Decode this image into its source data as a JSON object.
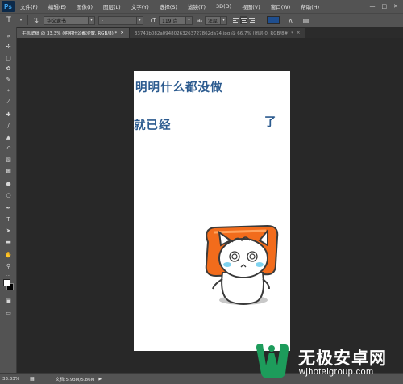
{
  "app": {
    "logo": "Ps"
  },
  "menu": {
    "items": [
      "文件(F)",
      "编辑(E)",
      "图像(I)",
      "图层(L)",
      "文字(Y)",
      "选择(S)",
      "滤镜(T)",
      "3D(D)",
      "视图(V)",
      "窗口(W)",
      "帮助(H)"
    ],
    "window_controls": [
      "minimize-icon",
      "maximize-icon",
      "close-icon"
    ]
  },
  "options": {
    "font_family": "华文隶书",
    "font_style": "-",
    "font_size": "119 点",
    "aa_label": "aₐ",
    "antialias": "浑厚",
    "text_color": "#1f4e8e",
    "tool_icon": "type-tool-icon"
  },
  "tabs": [
    {
      "label": "手机壁纸 @ 33.3% (明明什么都没做, RGB/8) *",
      "close": "×",
      "active": true
    },
    {
      "label": "33743b082a09480263263727862da74.jpg @ 66.7% (图层 0, RGB/8#) *",
      "close": "×",
      "active": false
    }
  ],
  "tools": [
    "move-tool-icon",
    "marquee-tool-icon",
    "lasso-tool-icon",
    "quick-select-tool-icon",
    "crop-tool-icon",
    "eyedropper-tool-icon",
    "spot-healing-tool-icon",
    "brush-tool-icon",
    "clone-stamp-tool-icon",
    "history-brush-tool-icon",
    "eraser-tool-icon",
    "gradient-tool-icon",
    "blur-tool-icon",
    "dodge-tool-icon",
    "pen-tool-icon",
    "type-tool-icon",
    "path-select-tool-icon",
    "rectangle-tool-icon",
    "hand-tool-icon",
    "zoom-tool-icon"
  ],
  "document": {
    "line1": "明明什么都没做",
    "line2": "就已经",
    "line3": "了",
    "text_color": "#2c5b8f",
    "sticker_colors": {
      "pillow": "#f26c1c",
      "cat_outline": "#3a3a3a",
      "blush": "#7fd3f0"
    }
  },
  "status": {
    "zoom": "33.33%",
    "doc_info": "文档:5.93M/5.86M",
    "arrow": "▶"
  },
  "watermark": {
    "title": "无极安卓网",
    "url": "wjhotelgroup.com",
    "logo_color": "#1d9c5b"
  }
}
